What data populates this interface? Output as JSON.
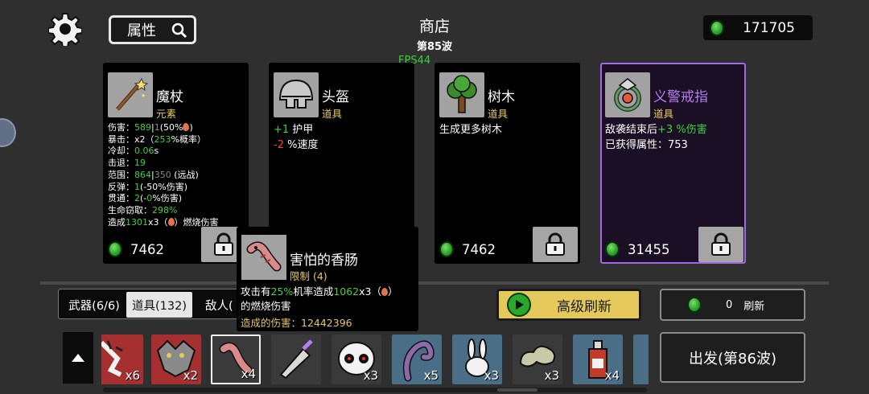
{
  "header": {
    "title": "商店",
    "wave": "第85波",
    "fps": "FPS44",
    "attr_label": "属性",
    "money": "171705"
  },
  "cards": [
    {
      "name": "魔杖",
      "type": "元素",
      "stats": [
        "伤害：589|1(50%",
        "暴击：x2（253%概率）",
        "冷却：0.06s",
        "击退：19",
        "范围：864|350 (远战)",
        "反弹：1(-50%伤害)",
        "贯通：2(-0%伤害)",
        "生命窃取：298%",
        "造成1301x3（ ）燃烧伤害"
      ],
      "price": "7462"
    },
    {
      "name": "头盔",
      "type": "道具",
      "stats": [
        "+1 护甲",
        "-2 %速度"
      ],
      "price": ""
    },
    {
      "name": "树木",
      "type": "道具",
      "stats": [
        "生成更多树木"
      ],
      "price": "7462"
    },
    {
      "name": "义警戒指",
      "type": "道具",
      "stats": [
        "敌袭结束后+3 %伤害",
        "已获得属性：753"
      ],
      "price": "31455"
    }
  ],
  "tooltip": {
    "name": "害怕的香肠",
    "type": "限制 (4)",
    "desc_line1": "攻击有25%机率造成1062x3（ ）",
    "desc_line2": "的燃烧伤害",
    "damage": "造成的伤害：12442396"
  },
  "tabs": {
    "weapons": "武器(6/6)",
    "items": "道具(132)",
    "enemies": "敌人("
  },
  "buttons": {
    "advanced_refresh": "高级刷新",
    "refresh_count": "0",
    "refresh": "刷新",
    "go": "出发(第86波)"
  },
  "inventory": [
    {
      "icon": "hand-icon",
      "count": "x6",
      "color": "red"
    },
    {
      "icon": "wolf-icon",
      "count": "x2",
      "color": "red"
    },
    {
      "icon": "sausage-icon",
      "count": "x4",
      "color": "grey"
    },
    {
      "icon": "syringe-icon",
      "count": "",
      "color": "grey"
    },
    {
      "icon": "skull-icon",
      "count": "x3",
      "color": "grey"
    },
    {
      "icon": "tentacle-icon",
      "count": "x5",
      "color": "blue"
    },
    {
      "icon": "rabbit-icon",
      "count": "x3",
      "color": "blue"
    },
    {
      "icon": "cloud-icon",
      "count": "x3",
      "color": "grey"
    },
    {
      "icon": "bottle-icon",
      "count": "x4",
      "color": "blue"
    }
  ],
  "colors": {
    "background": "#2f2f2f",
    "gold": "#e6c95c",
    "green": "#3fd23f",
    "red": "#ff4040",
    "purple": "#b67ef2"
  }
}
